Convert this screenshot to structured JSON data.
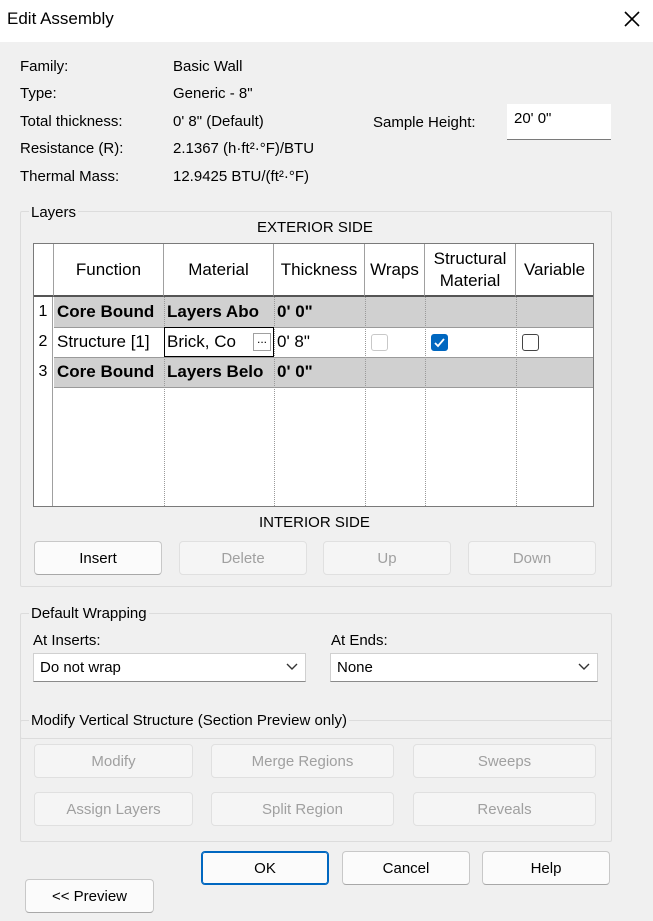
{
  "window": {
    "title": "Edit Assembly"
  },
  "props": [
    {
      "label": "Family:",
      "value": "Basic Wall"
    },
    {
      "label": "Type:",
      "value": "Generic - 8\""
    },
    {
      "label": "Total thickness:",
      "value": "0'  8\" (Default)"
    },
    {
      "label": "Resistance (R):",
      "value": "2.1367 (h·ft²·°F)/BTU"
    },
    {
      "label": "Thermal Mass:",
      "value": "12.9425 BTU/(ft²·°F)"
    }
  ],
  "sample_height": {
    "label": "Sample Height:",
    "value": "20'  0\""
  },
  "layers": {
    "title": "Layers",
    "exterior_label": "EXTERIOR SIDE",
    "interior_label": "INTERIOR SIDE",
    "columns": [
      "Function",
      "Material",
      "Thickness",
      "Wraps",
      "Structural Material",
      "Variable"
    ],
    "columns_split": {
      "structural_line1": "Structural",
      "structural_line2": "Material"
    },
    "rows": [
      {
        "num": "1",
        "function": "Core Bound",
        "material": "Layers Abo",
        "thickness": "0'  0\"",
        "bold": true
      },
      {
        "num": "2",
        "function": "Structure [1]",
        "material": "Brick, Co",
        "material_browse": "...",
        "thickness": "0'  8\"",
        "wraps": false,
        "structural": true,
        "variable": false
      },
      {
        "num": "3",
        "function": "Core Bound",
        "material": "Layers Belo",
        "thickness": "0'  0\"",
        "bold": true
      }
    ],
    "buttons": {
      "insert": "Insert",
      "delete": "Delete",
      "up": "Up",
      "down": "Down"
    }
  },
  "wrapping": {
    "title": "Default Wrapping",
    "at_inserts_label": "At Inserts:",
    "at_inserts_value": "Do not wrap",
    "at_ends_label": "At  Ends:",
    "at_ends_value": "None"
  },
  "vertical": {
    "title": "Modify Vertical Structure (Section Preview only)",
    "buttons": {
      "modify": "Modify",
      "merge": "Merge Regions",
      "sweeps": "Sweeps",
      "assign": "Assign Layers",
      "split": "Split Region",
      "reveals": "Reveals"
    }
  },
  "footer": {
    "ok": "OK",
    "cancel": "Cancel",
    "help": "Help",
    "preview": "<< Preview"
  },
  "colors": {
    "accent": "#0067c0",
    "row_gray": "#d0d0d0"
  }
}
